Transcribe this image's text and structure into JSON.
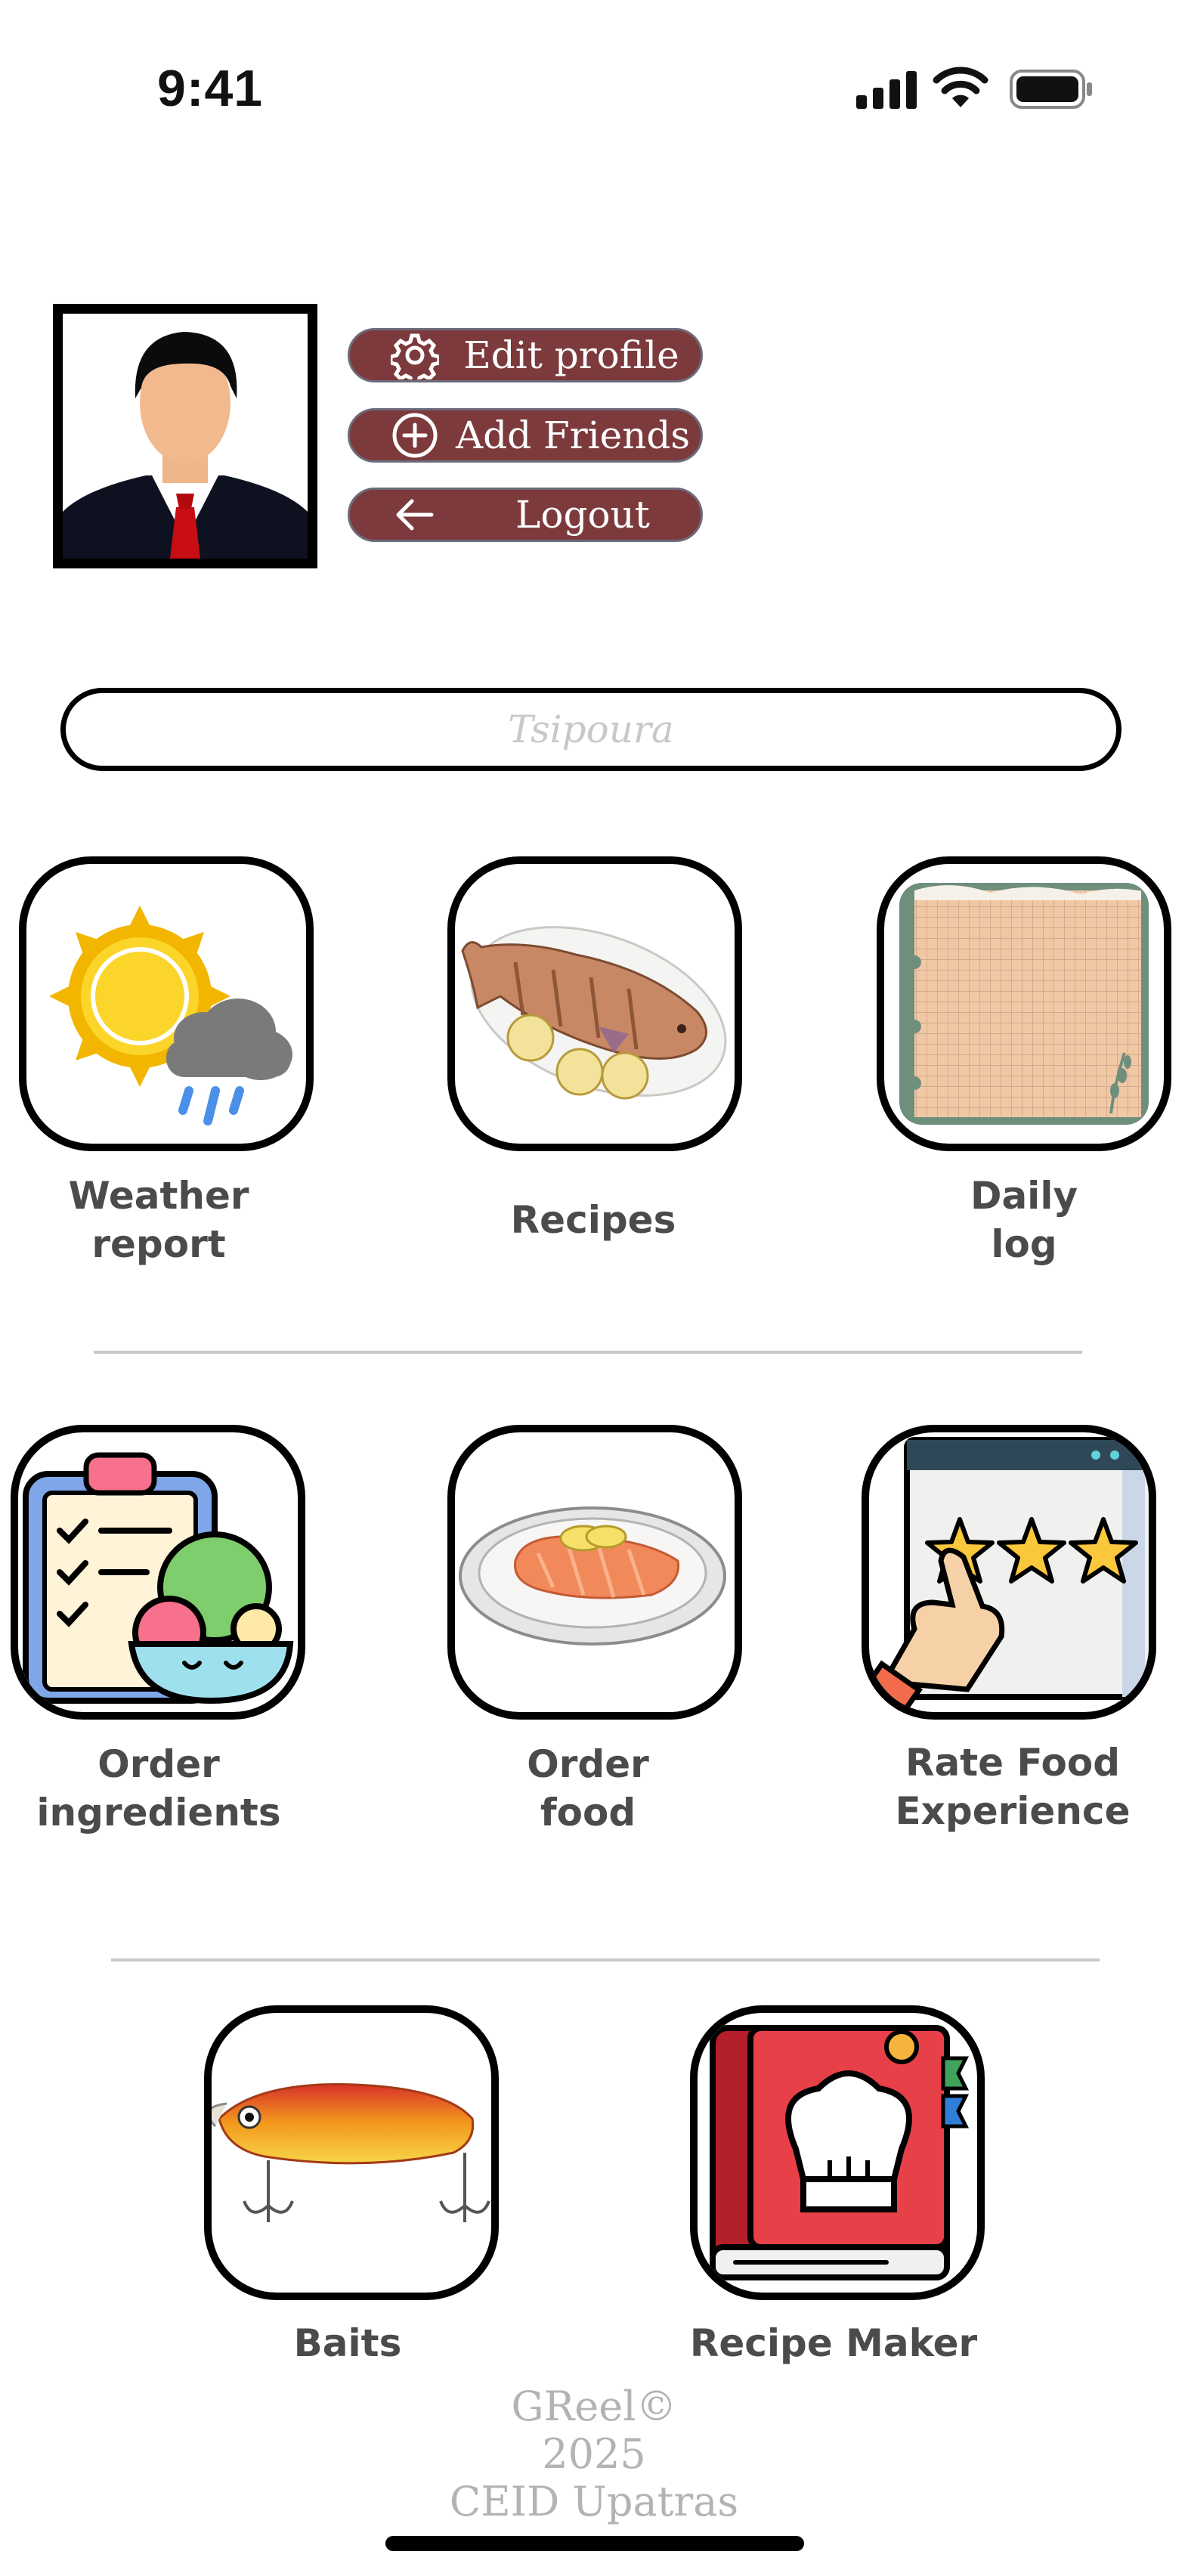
{
  "status_bar": {
    "time": "9:41"
  },
  "profile": {
    "buttons": [
      {
        "label": "Edit profile",
        "icon": "gear-icon"
      },
      {
        "label": "Add Friends",
        "icon": "plus-circle-icon"
      },
      {
        "label": "Logout",
        "icon": "arrow-left-icon"
      }
    ]
  },
  "search": {
    "placeholder": "Tsipoura"
  },
  "tiles": [
    {
      "label": "Weather\nreport",
      "icon": "weather-icon"
    },
    {
      "label": "Recipes",
      "icon": "grilled-fish-icon"
    },
    {
      "label": "Daily\nlog",
      "icon": "notebook-icon"
    },
    {
      "label": "Order\ningredients",
      "icon": "clipboard-salad-icon"
    },
    {
      "label": "Order\nfood",
      "icon": "salmon-plate-icon"
    },
    {
      "label": "Rate Food\nExperience",
      "icon": "rating-stars-icon"
    },
    {
      "label": "Baits",
      "icon": "fishing-lure-icon"
    },
    {
      "label": "Recipe Maker",
      "icon": "cookbook-icon"
    }
  ],
  "footer": {
    "line1": "GReel©",
    "line2": "2025",
    "line3": "CEID Upatras"
  },
  "colors": {
    "button_bg": "#7d3a3d",
    "label_text": "#4b4b4b",
    "footer_text": "#b3b3b3"
  }
}
